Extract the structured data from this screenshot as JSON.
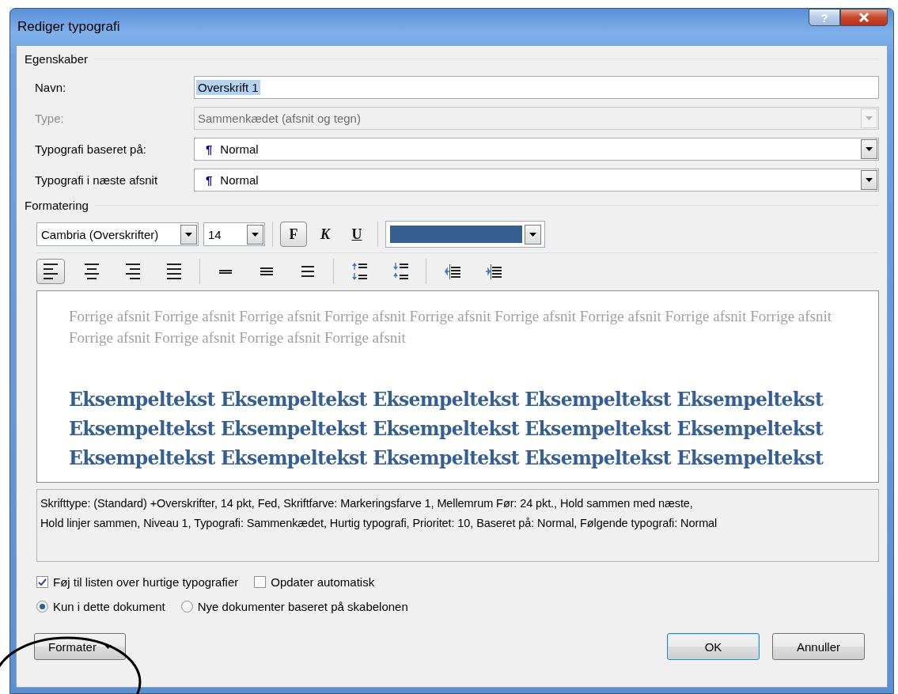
{
  "window": {
    "title": "Rediger typografi",
    "help": "?"
  },
  "properties": {
    "heading": "Egenskaber",
    "fields": [
      {
        "kind": "text",
        "label": "Navn:",
        "value": "Overskrift 1",
        "selected": true,
        "disabled": false
      },
      {
        "kind": "dropdown",
        "label": "Type:",
        "value": "Sammenkædet (afsnit og tegn)",
        "disabled": true
      },
      {
        "kind": "dropdown",
        "label": "Typografi baseret på:",
        "symbol": "¶",
        "value": "Normal",
        "disabled": false
      },
      {
        "kind": "dropdown",
        "label": "Typografi i næste afsnit",
        "symbol": "¶",
        "value": "Normal",
        "disabled": false
      }
    ]
  },
  "formatting": {
    "heading": "Formatering",
    "font": "Cambria (Overskrifter)",
    "size": "14",
    "styles": [
      {
        "kind": "bold",
        "label": "F",
        "selected": true
      },
      {
        "kind": "italic",
        "label": "K",
        "selected": false
      },
      {
        "kind": "underline",
        "label": "U",
        "selected": false
      }
    ],
    "color": "#365f91",
    "tools": [
      {
        "kind": "align-left",
        "selected": true
      },
      {
        "kind": "align-center",
        "selected": false
      },
      {
        "kind": "align-right",
        "selected": false
      },
      {
        "kind": "justify",
        "selected": false
      },
      {
        "kind": "sep"
      },
      {
        "kind": "single-spacing",
        "selected": false
      },
      {
        "kind": "one-half-spacing",
        "selected": false
      },
      {
        "kind": "double-spacing",
        "selected": false
      },
      {
        "kind": "sep"
      },
      {
        "kind": "space-increase",
        "selected": false
      },
      {
        "kind": "space-decrease",
        "selected": false
      },
      {
        "kind": "sep"
      },
      {
        "kind": "indent-decrease",
        "selected": false
      },
      {
        "kind": "indent-increase",
        "selected": false
      }
    ]
  },
  "preview": {
    "previous_lines": [
      "Forrige afsnit Forrige afsnit Forrige afsnit Forrige afsnit Forrige afsnit Forrige afsnit Forrige afsnit Forrige afsnit Forrige afsnit",
      "Forrige afsnit Forrige afsnit Forrige afsnit Forrige afsnit"
    ],
    "sample_lines": [
      "Eksempeltekst Eksempeltekst Eksempeltekst Eksempeltekst Eksempeltekst",
      "Eksempeltekst Eksempeltekst Eksempeltekst Eksempeltekst Eksempeltekst",
      "Eksempeltekst Eksempeltekst Eksempeltekst Eksempeltekst Eksempeltekst"
    ]
  },
  "description_lines": [
    "Skrifttype: (Standard) +Overskrifter, 14 pkt, Fed, Skriftfarve: Markeringsfarve 1, Mellemrum Før:  24 pkt., Hold sammen med næste,",
    "Hold linjer sammen, Niveau 1, Typografi: Sammenkædet, Hurtig typografi, Prioritet: 10, Baseret på: Normal, Følgende typografi: Normal"
  ],
  "checkboxes": [
    {
      "label": "Føj til listen over hurtige typografier",
      "checked": true
    },
    {
      "label": "Opdater automatisk",
      "checked": false
    }
  ],
  "radios": [
    {
      "label": "Kun i dette dokument",
      "selected": true
    },
    {
      "label": "Nye dokumenter baseret på skabelonen",
      "selected": false
    }
  ],
  "buttons": [
    {
      "kind": "menu",
      "label": "Formater"
    },
    {
      "kind": "default",
      "label": "OK"
    },
    {
      "kind": "normal",
      "label": "Annuller"
    }
  ]
}
